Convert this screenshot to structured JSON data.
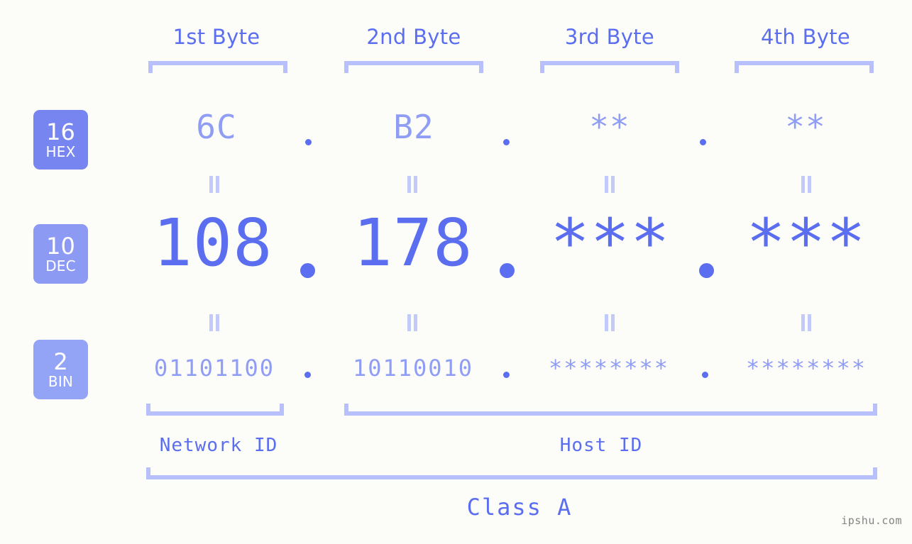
{
  "background_color": "#fcfdf9",
  "accent_color": "#5b6ef0",
  "accent_light": "#909df5",
  "bracket_color": "#b7c0fb",
  "byte_headers": [
    {
      "label": "1st Byte"
    },
    {
      "label": "2nd Byte"
    },
    {
      "label": "3rd Byte"
    },
    {
      "label": "4th Byte"
    }
  ],
  "radix_badges": [
    {
      "number": "16",
      "name": "HEX",
      "color": "#7685ef"
    },
    {
      "number": "10",
      "name": "DEC",
      "color": "#8d9af4"
    },
    {
      "number": "2",
      "name": "BIN",
      "color": "#93a4f7"
    }
  ],
  "rows": {
    "hex": {
      "values": [
        "6C",
        "B2",
        "**",
        "**"
      ],
      "separator": "."
    },
    "dec": {
      "values": [
        "108",
        "178",
        "***",
        "***"
      ],
      "separator": "."
    },
    "bin": {
      "values": [
        "01101100",
        "10110010",
        "********",
        "********"
      ],
      "separator": "."
    }
  },
  "equality_marker": "=",
  "segments": {
    "network_id": "Network ID",
    "host_id": "Host ID"
  },
  "class_label": "Class A",
  "watermark": "ipshu.com"
}
